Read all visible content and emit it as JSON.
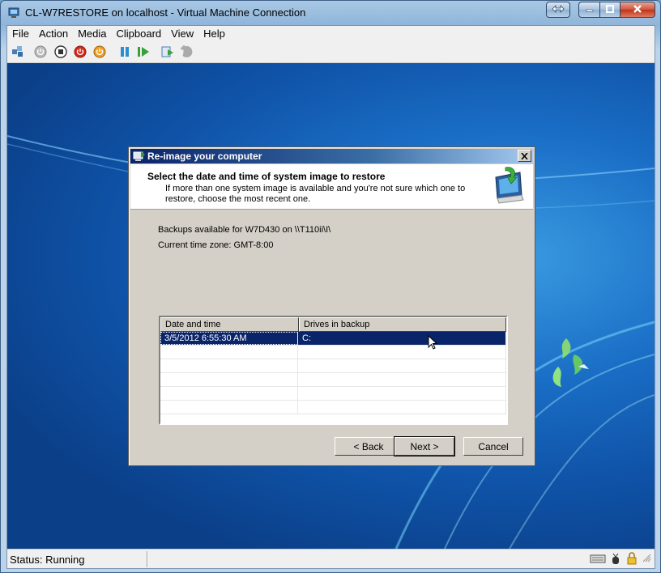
{
  "window": {
    "title": "CL-W7RESTORE on localhost - Virtual Machine Connection",
    "icon": "vm-connection-icon"
  },
  "menu": {
    "items": [
      "File",
      "Action",
      "Media",
      "Clipboard",
      "View",
      "Help"
    ]
  },
  "toolbar": {
    "buttons": [
      "ctrl-alt-del-icon",
      "start-icon",
      "turn-off-icon",
      "shut-down-icon",
      "save-icon",
      "pause-icon",
      "start-play-icon",
      "snapshot-icon",
      "revert-icon"
    ]
  },
  "dialog": {
    "title": "Re-image your computer",
    "heading": "Select the date and time of system image to restore",
    "subtext": "If more than one system image is available and you're not sure which one to restore, choose the most recent one.",
    "backups_label": "Backups available for W7D430 on \\\\T110ii\\I\\",
    "timezone_label": "Current time zone: GMT-8:00",
    "table": {
      "columns": [
        "Date and time",
        "Drives in backup"
      ],
      "rows": [
        {
          "date": "3/5/2012 6:55:30 AM",
          "drives": "C:"
        }
      ]
    },
    "buttons": {
      "back": "< Back",
      "next": "Next >",
      "cancel": "Cancel"
    }
  },
  "status": {
    "text": "Status: Running"
  },
  "colors": {
    "selection": "#0a246a",
    "desktop": "#1a6ec6"
  }
}
